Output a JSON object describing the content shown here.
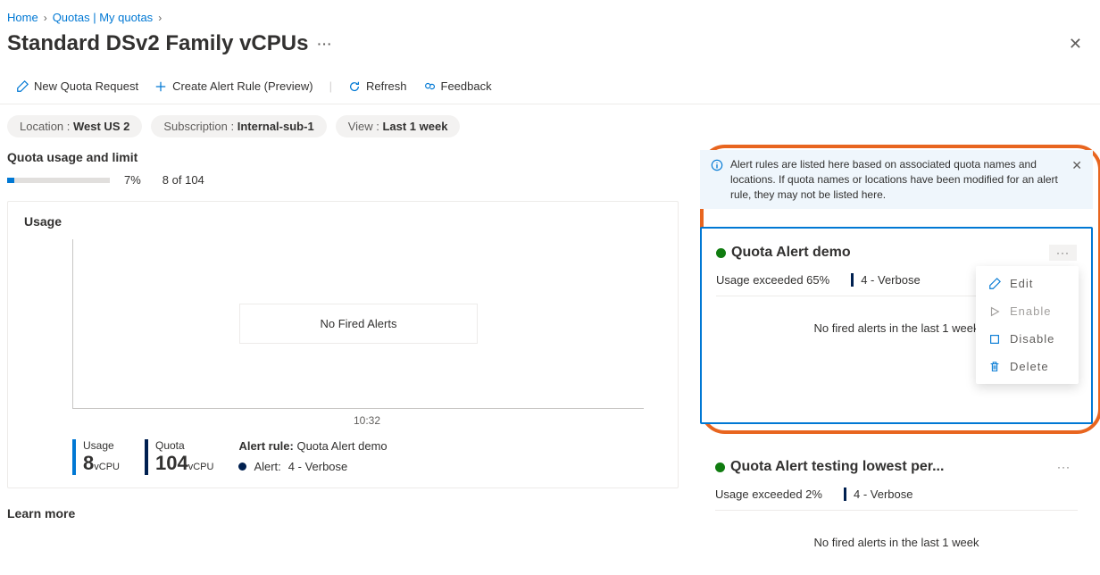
{
  "breadcrumb": {
    "home": "Home",
    "quotas": "Quotas | My quotas"
  },
  "page_title": "Standard DSv2 Family vCPUs",
  "toolbar": {
    "new_quota": "New Quota Request",
    "create_alert": "Create Alert Rule (Preview)",
    "refresh": "Refresh",
    "feedback": "Feedback"
  },
  "filters": {
    "location_label": "Location : ",
    "location_value": "West US 2",
    "subscription_label": "Subscription : ",
    "subscription_value": "Internal-sub-1",
    "view_label": "View : ",
    "view_value": "Last 1 week"
  },
  "quota_usage": {
    "title": "Quota usage and limit",
    "percent": "7%",
    "percent_num": 7,
    "count": "8 of 104"
  },
  "usage_card": {
    "title": "Usage",
    "no_fired": "No Fired Alerts",
    "xaxis": "10:32",
    "usage_label": "Usage",
    "usage_value": "8",
    "usage_unit": "vCPU",
    "quota_label": "Quota",
    "quota_value": "104",
    "quota_unit": "vCPU",
    "alert_rule_label": "Alert rule:",
    "alert_rule_value": "Quota Alert demo",
    "alert_label": "Alert:",
    "alert_value": "4 - Verbose"
  },
  "learn_more": "Learn more",
  "info_banner": "Alert rules are listed here based on associated quota names and locations. If quota names or locations have been modified for an alert rule, they may not be listed here.",
  "alert1": {
    "title": "Quota Alert demo",
    "usage": "Usage exceeded 65%",
    "severity": "4 - Verbose",
    "no_fired": "No fired alerts in the last 1 week"
  },
  "alert2": {
    "title": "Quota Alert testing lowest per...",
    "usage": "Usage exceeded 2%",
    "severity": "4 - Verbose",
    "no_fired": "No fired alerts in the last 1 week"
  },
  "context_menu": {
    "edit": "Edit",
    "enable": "Enable",
    "disable": "Disable",
    "delete": "Delete"
  },
  "chart_data": {
    "type": "line",
    "title": "Usage",
    "series": [],
    "x": [
      "10:32"
    ],
    "note": "No Fired Alerts — no data points plotted",
    "metrics": {
      "usage_vcpu": 8,
      "quota_vcpu": 104
    }
  }
}
